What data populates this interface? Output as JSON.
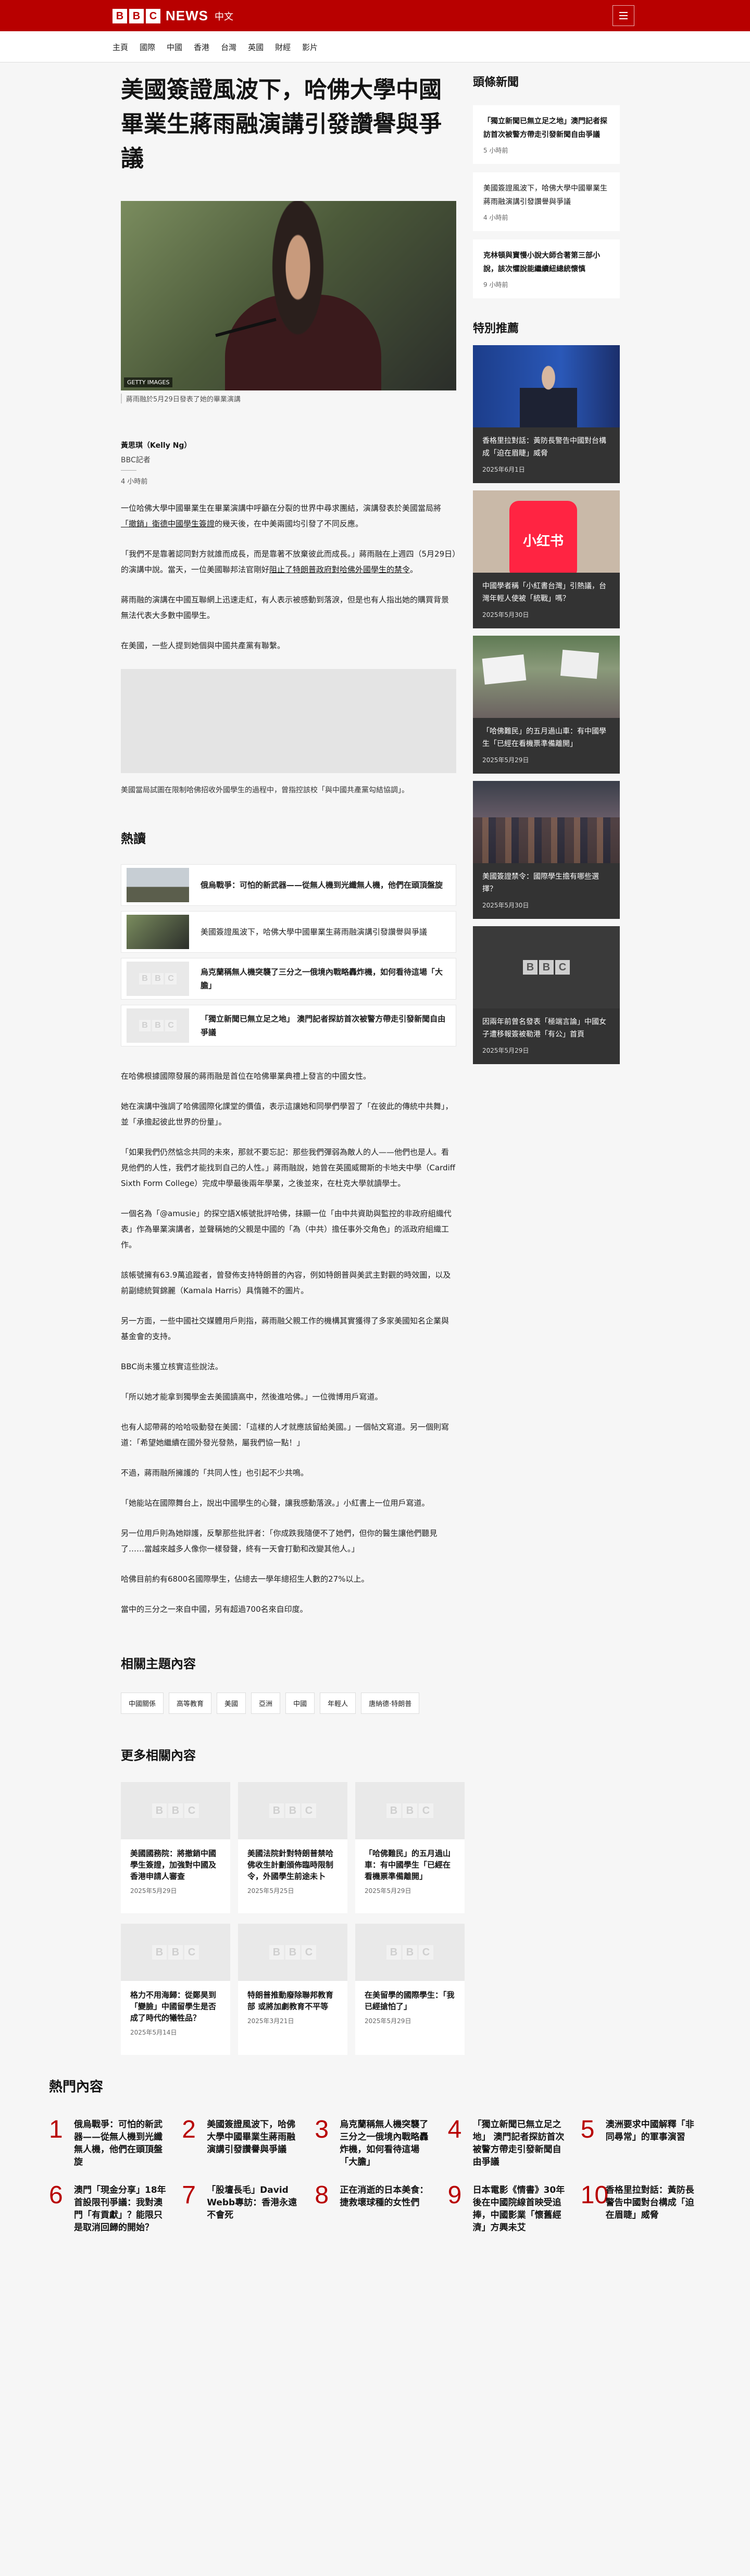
{
  "header": {
    "logo_letters": [
      "B",
      "B",
      "C"
    ],
    "logo_news": "NEWS",
    "logo_lang": "中文",
    "menu_icon": "hamburger-icon",
    "brand_color": "#b80000"
  },
  "nav": [
    "主頁",
    "國際",
    "中國",
    "香港",
    "台灣",
    "英國",
    "財經",
    "影片"
  ],
  "article": {
    "headline": "美國簽證風波下，哈佛大學中國畢業生蔣雨融演講引發讚譽與爭議",
    "hero_credit": "GETTY IMAGES",
    "hero_caption": "蔣雨融於5月29日發表了她的畢業演講",
    "author": "黃思琪（Kelly Ng）",
    "author_role": "BBC記者",
    "time": "4 小時前",
    "p1_a": "一位哈佛大學中國畢業生在畢業演講中呼籲在分裂的世界中尋求團結，演講發表於美國當局將",
    "p1_link1": "「撤銷」衛德中國學生簽證",
    "p1_b": "的幾天後，在中美兩國均引發了不同反應。",
    "p2_a": "「我們不是靠著認同對方就誰而成長，而是靠著不放棄彼此而成長。」蔣雨融在上週四（5月29日）的演講中說。當天，一位美國聯邦法官剛好",
    "p2_link": "阻止了特朗普政府對哈佛外國學生的禁令",
    "p2_b": "。",
    "p3": "蔣雨融的演講在中國互聯網上迅速走紅，有人表示被感動到落淚，但是也有人指出她的購買背景無法代表大多數中國學生。",
    "p4": "在美國，一些人提到她個與中國共產黨有聯繫。",
    "embed_caption": "美國當局試圖在限制哈佛招收外國學生的過程中，曾指控該校「與中國共產黨勾結協調」。",
    "p5": "在哈佛根據國際發展的蔣雨融是首位在哈佛畢業典禮上發言的中國女性。",
    "p6": "她在演講中強調了哈佛國際化課堂的價值，表示這讓她和同學們學習了「在彼此的傳統中共舞」，並「承擔起彼此世界的份量」。",
    "p7": "「如果我們仍然惦念共同的未來，那就不要忘記：那些我們彈弱為敵人的人——他們也是人。看見他們的人性，我們才能找到自己的人性。」蔣雨融說，她曾在英國威爾斯的卡地夫中學（Cardiff Sixth Form College）完成中學最後兩年學業，之後並來，在杜克大學就讀學士。",
    "p8": "一個名為「@amusie」的探空語X帳號批評哈佛，抹顯一位「由中共資助與監控的非政府組織代表」作為畢業演講者，並聲稱她的父親是中國的「為（中共）擔任事外交角色」的派政府組織工作。",
    "p9": "該帳號擁有63.9萬追蹤者，曾發佈支持特朗普的內容，例如特朗普與美武主對觀的時效圖，以及前副總統賀錦麗（Kamala Harris）具惰雜不的圖片。",
    "p10": "另一方面，一些中國社交媒體用戶則指，蔣雨融父親工作的機構其實獲得了多家美國知名企業與基金會的支持。",
    "p11": "BBC尚未獲立核實這些說法。",
    "p12": "「所以她才能拿到獨學金去美國讀高中，然後進哈佛。」一位微博用戶寫道。",
    "p13": "也有人認帶蔣的哈哈吸動發在美國：「這樣的人才就應該留給美國。」一個帖文寫道。另一個則寫道：「希望她繼續在國外發光發熱，屬我們協一點！」",
    "p14": "不過，蔣雨融所擁護的「共同人性」也引起不少共鳴。",
    "p15": "「她能站在國際舞台上，說出中國學生的心聲，讓我感動落淚。」小紅書上一位用戶寫道。",
    "p16": "另一位用戶則為她辯護，反擊那些批評者：「你成跌我隨便不了她們，但你的醫生讓他們聽見了……當越來越多人像你一樣發聲，終有一天會打動和改變其他人。」",
    "p17": "哈佛目前約有6800名國際學生，佔總去一學年總招生人數的27%以上。",
    "p18": "當中的三分之一來自中國，另有超過700名來自印度。"
  },
  "hot": {
    "title": "熱讀",
    "items": [
      {
        "text": "俄烏戰爭：可怕的新武器——從無人機到光纖無人機，他們在頭頂盤旋",
        "thumb": "photo"
      },
      {
        "text": "美國簽證風波下，哈佛大學中國畢業生蔣雨融演講引發讚譽與爭議",
        "thumb": "photo"
      },
      {
        "text": "烏克蘭稱無人機突襲了三分之一俄境內戰略轟炸機，如何看待這場「大膽」",
        "thumb": "bbc"
      },
      {
        "text": "「獨立新聞已無立足之地」 澳門記者探訪首次被警方帶走引發新聞自由爭議",
        "thumb": "bbc"
      }
    ]
  },
  "topics": {
    "title": "相關主題內容",
    "items": [
      "中國關係",
      "高等教育",
      "美國",
      "亞洲",
      "中國",
      "年輕人",
      "唐納德·特朗普"
    ]
  },
  "more": {
    "title": "更多相關內容",
    "items": [
      {
        "title": "美國國務院：將撤銷中國學生簽證，加強對中國及香港申請人審查",
        "date": "2025年5月29日"
      },
      {
        "title": "美國法院針對特朗普禁哈佛收生計劃頒佈臨時限制令，外國學生前途未卜",
        "date": "2025年5月25日"
      },
      {
        "title": "「哈佛難民」的五月過山車：有中國學生「已經在看機票準備離開」",
        "date": "2025年5月29日"
      },
      {
        "title": "格力不用海歸：從鄭昊到「變臉」中國留學生是否成了時代的犧牲品？",
        "date": "2025年5月14日"
      },
      {
        "title": "特朗普推動廢除聯邦教育部 或將加劇教育不平等",
        "date": "2025年3月21日"
      },
      {
        "title": "在美留學的國際學生：「我已經搶怕了」",
        "date": "2025年5月29日"
      }
    ]
  },
  "sidebar": {
    "news_title": "頭條新聞",
    "news": [
      {
        "text": "「獨立新聞已無立足之地」澳門記者探訪首次被警方帶走引發新聞自由爭議",
        "time": "5 小時前"
      },
      {
        "text": "美國簽證風波下，哈佛大學中國畢業生蔣雨融演講引發讚譽與爭議",
        "time": "4 小時前"
      },
      {
        "text": "克林頓與寶慢小說大師合著第三部小說，該次懼說能繼續紐總統懷慎",
        "time": "9 小時前"
      }
    ],
    "feature_title": "特別推薦",
    "features": [
      {
        "text": "香格里拉對話：黃防長警告中國對台構成「迫在眉睫」威脅",
        "date": "2025年6月1日",
        "img": "stage"
      },
      {
        "text": "中國學者稱「小紅書台灣」引熱議，台灣年輕人使被「統戰」嗎？",
        "date": "2025年5月30日",
        "img": "xhs",
        "img_label": "小红书"
      },
      {
        "text": "「哈佛難民」的五月過山車：有中國學生「已經在看機票準備離開」",
        "date": "2025年5月29日",
        "img": "protest"
      },
      {
        "text": "美國簽證禁令：國際學生擔有哪些選擇？",
        "date": "2025年5月30日",
        "img": "crowd"
      },
      {
        "text": "因兩年前曾名發表「極端言論」中國女子遭移報簽被勒港「有公」首頁",
        "date": "2025年5月29日",
        "img": "bbc"
      }
    ]
  },
  "popular": {
    "title": "熱門內容",
    "items": [
      {
        "num": "1",
        "text": "俄烏戰爭：可怕的新武器——從無人機到光纖無人機，他們在頭頂盤旋"
      },
      {
        "num": "2",
        "text": "美國簽證風波下，哈佛大學中國畢業生蔣雨融演講引發讚譽與爭議"
      },
      {
        "num": "3",
        "text": "烏克蘭稱無人機突襲了三分之一俄境內戰略轟炸機，如何看待這場「大膽」"
      },
      {
        "num": "4",
        "text": "「獨立新聞已無立足之地」 澳門記者探訪首次被警方帶走引發新聞自由爭議"
      },
      {
        "num": "5",
        "text": "澳洲要求中國解釋「非同尋常」的軍事演習"
      },
      {
        "num": "6",
        "text": "澳門「現金分享」18年首設限刊爭議：我對澳門「有貢獻」？能限只是取消回歸的開始？"
      },
      {
        "num": "7",
        "text": "「股壇長毛」David Webb專訪：香港永遠不會死"
      },
      {
        "num": "8",
        "text": "正在消逝的日本美食：捷救壞球種的女性們"
      },
      {
        "num": "9",
        "text": "日本電影《情書》30年後在中國院線首映受追捧，中國影業「懷舊經濟」方興未艾"
      },
      {
        "num": "10",
        "text": "香格里拉對話：黃防長警告中國對台構成「迫在眉睫」威脅"
      }
    ]
  }
}
